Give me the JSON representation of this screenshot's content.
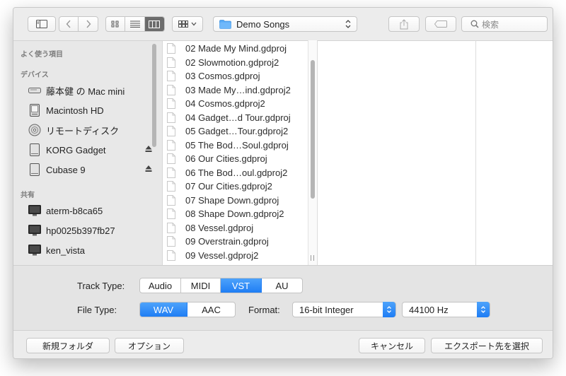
{
  "toolbar": {
    "location": "Demo Songs",
    "search_placeholder": "検索"
  },
  "sidebar": {
    "sections": [
      {
        "title": "よく使う項目"
      },
      {
        "title": "デバイス"
      },
      {
        "title": "共有"
      }
    ],
    "devices": [
      {
        "label": "藤本健 の Mac mini",
        "icon": "mac-mini-icon"
      },
      {
        "label": "Macintosh HD",
        "icon": "hard-drive-icon"
      },
      {
        "label": "リモートディスク",
        "icon": "remote-disc-icon"
      },
      {
        "label": "KORG Gadget",
        "icon": "external-drive-icon",
        "eject": true
      },
      {
        "label": "Cubase 9",
        "icon": "external-drive-icon",
        "eject": true
      }
    ],
    "shared": [
      {
        "label": "aterm-b8ca65",
        "icon": "display-icon"
      },
      {
        "label": "hp0025b397fb27",
        "icon": "display-icon"
      },
      {
        "label": "ken_vista",
        "icon": "display-icon"
      }
    ]
  },
  "files": [
    "02 Made My Mind.gdproj",
    "02 Slowmotion.gdproj2",
    "03 Cosmos.gdproj",
    "03 Made My…ind.gdproj2",
    "04 Cosmos.gdproj2",
    "04 Gadget…d Tour.gdproj",
    "05 Gadget…Tour.gdproj2",
    "05 The Bod…Soul.gdproj",
    "06 Our Cities.gdproj",
    "06 The Bod…oul.gdproj2",
    "07 Our Cities.gdproj2",
    "07 Shape Down.gdproj",
    "08 Shape Down.gdproj2",
    "08 Vessel.gdproj",
    "09 Overstrain.gdproj",
    "09 Vessel.gdproj2"
  ],
  "options": {
    "track_type_label": "Track Type:",
    "track_types": [
      "Audio",
      "MIDI",
      "VST",
      "AU"
    ],
    "track_type_selected": "VST",
    "file_type_label": "File Type:",
    "file_types": [
      "WAV",
      "AAC"
    ],
    "file_type_selected": "WAV",
    "format_label": "Format:",
    "format_value": "16-bit Integer",
    "sample_rate_value": "44100 Hz"
  },
  "footer": {
    "new_folder": "新規フォルダ",
    "options": "オプション",
    "cancel": "キャンセル",
    "export": "エクスポート先を選択"
  },
  "colors": {
    "accent": "#1f7df4",
    "folder": "#57aaf6"
  }
}
